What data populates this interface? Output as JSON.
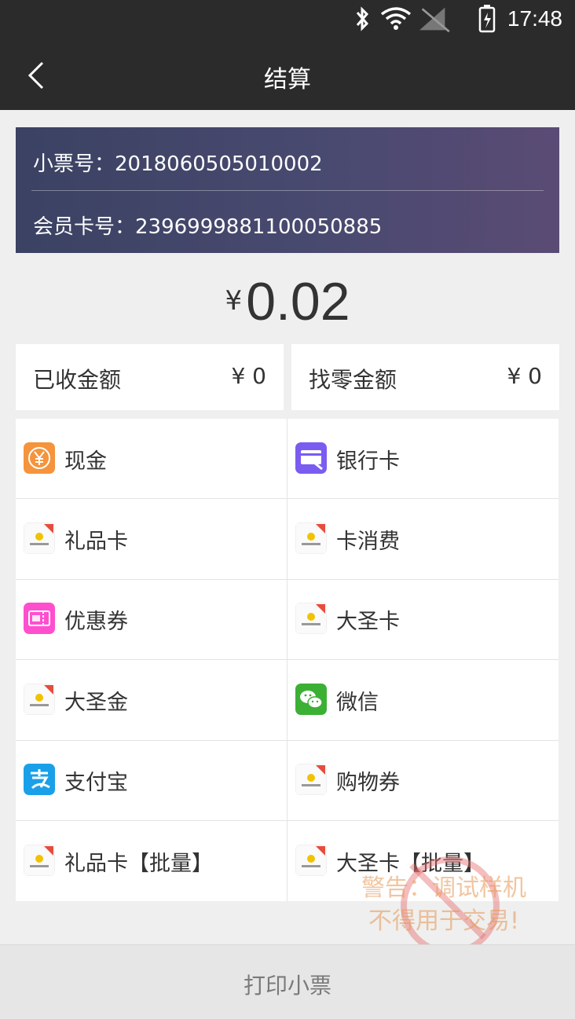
{
  "status_bar": {
    "time": "17:48"
  },
  "header": {
    "title": "结算"
  },
  "receipt": {
    "ticket_label": "小票号：2018060505010002",
    "member_label": "会员卡号：2396999881100050885"
  },
  "amount": {
    "currency": "¥",
    "value": "0.02"
  },
  "received": {
    "label": "已收金额",
    "value": "¥ 0"
  },
  "change": {
    "label": "找零金额",
    "value": "¥ 0"
  },
  "payment_methods": [
    {
      "label": "现金",
      "icon": "cash-icon"
    },
    {
      "label": "银行卡",
      "icon": "bank-card-icon"
    },
    {
      "label": "礼品卡",
      "icon": "gift-card-icon"
    },
    {
      "label": "卡消费",
      "icon": "card-consume-icon"
    },
    {
      "label": "优惠券",
      "icon": "coupon-icon"
    },
    {
      "label": "大圣卡",
      "icon": "dasheng-card-icon"
    },
    {
      "label": "大圣金",
      "icon": "dasheng-gold-icon"
    },
    {
      "label": "微信",
      "icon": "wechat-icon"
    },
    {
      "label": "支付宝",
      "icon": "alipay-icon"
    },
    {
      "label": "购物券",
      "icon": "shopping-voucher-icon"
    },
    {
      "label": "礼品卡【批量】",
      "icon": "gift-card-batch-icon"
    },
    {
      "label": "大圣卡【批量】",
      "icon": "dasheng-card-batch-icon"
    }
  ],
  "footer": {
    "print_label": "打印小票"
  },
  "watermark": {
    "line1": "警告：调试样机",
    "line2": "不得用于交易!"
  },
  "colors": {
    "cash": "#f5943c",
    "bank": "#7a5cf0",
    "coupon": "#ff4fcf",
    "wechat": "#3cb034",
    "alipay": "#1aa0e8",
    "card_bg": "#3b4263"
  }
}
